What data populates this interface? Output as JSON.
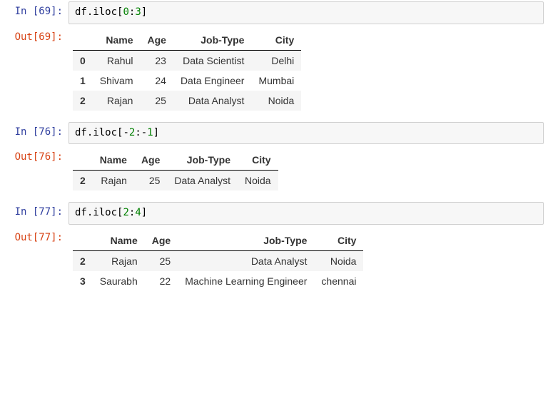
{
  "cells": [
    {
      "id": "c0",
      "in_prompt": "In [69]:",
      "out_prompt": "Out[69]:",
      "code_tokens": [
        {
          "t": "df",
          "c": "code-plain"
        },
        {
          "t": ".",
          "c": "code-plain"
        },
        {
          "t": "iloc",
          "c": "code-plain"
        },
        {
          "t": "[",
          "c": "code-plain"
        },
        {
          "t": "0",
          "c": "code-num"
        },
        {
          "t": ":",
          "c": "code-plain"
        },
        {
          "t": "3",
          "c": "code-num"
        },
        {
          "t": "]",
          "c": "code-plain"
        }
      ],
      "columns": [
        "",
        "Name",
        "Age",
        "Job-Type",
        "City"
      ],
      "rows": [
        {
          "idx": "0",
          "Name": "Rahul",
          "Age": "23",
          "Job-Type": "Data Scientist",
          "City": "Delhi"
        },
        {
          "idx": "1",
          "Name": "Shivam",
          "Age": "24",
          "Job-Type": "Data Engineer",
          "City": "Mumbai"
        },
        {
          "idx": "2",
          "Name": "Rajan",
          "Age": "25",
          "Job-Type": "Data Analyst",
          "City": "Noida"
        }
      ]
    },
    {
      "id": "c1",
      "in_prompt": "In [76]:",
      "out_prompt": "Out[76]:",
      "code_tokens": [
        {
          "t": "df",
          "c": "code-plain"
        },
        {
          "t": ".",
          "c": "code-plain"
        },
        {
          "t": "iloc",
          "c": "code-plain"
        },
        {
          "t": "[",
          "c": "code-plain"
        },
        {
          "t": "-",
          "c": "code-plain"
        },
        {
          "t": "2",
          "c": "code-num"
        },
        {
          "t": ":",
          "c": "code-plain"
        },
        {
          "t": "-",
          "c": "code-plain"
        },
        {
          "t": "1",
          "c": "code-num"
        },
        {
          "t": "]",
          "c": "code-plain"
        }
      ],
      "columns": [
        "",
        "Name",
        "Age",
        "Job-Type",
        "City"
      ],
      "rows": [
        {
          "idx": "2",
          "Name": "Rajan",
          "Age": "25",
          "Job-Type": "Data Analyst",
          "City": "Noida"
        }
      ]
    },
    {
      "id": "c2",
      "in_prompt": "In [77]:",
      "out_prompt": "Out[77]:",
      "code_tokens": [
        {
          "t": "df",
          "c": "code-plain"
        },
        {
          "t": ".",
          "c": "code-plain"
        },
        {
          "t": "iloc",
          "c": "code-plain"
        },
        {
          "t": "[",
          "c": "code-plain"
        },
        {
          "t": "2",
          "c": "code-num"
        },
        {
          "t": ":",
          "c": "code-plain"
        },
        {
          "t": "4",
          "c": "code-num"
        },
        {
          "t": "]",
          "c": "code-plain"
        }
      ],
      "columns": [
        "",
        "Name",
        "Age",
        "Job-Type",
        "City"
      ],
      "rows": [
        {
          "idx": "2",
          "Name": "Rajan",
          "Age": "25",
          "Job-Type": "Data Analyst",
          "City": "Noida"
        },
        {
          "idx": "3",
          "Name": "Saurabh",
          "Age": "22",
          "Job-Type": "Machine Learning Engineer",
          "City": "chennai"
        }
      ]
    }
  ]
}
